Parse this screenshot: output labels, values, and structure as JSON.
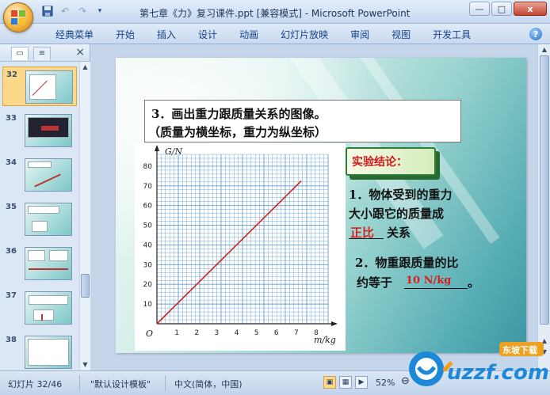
{
  "window": {
    "title": "第七章《力》复习课件.ppt [兼容模式] - Microsoft PowerPoint",
    "controls": [
      "—",
      "□",
      "x"
    ]
  },
  "qat": {
    "undo": "↶",
    "redo": "↷"
  },
  "ribbon": {
    "tabs": [
      "经典菜单",
      "开始",
      "插入",
      "设计",
      "动画",
      "幻灯片放映",
      "审阅",
      "视图",
      "开发工具"
    ],
    "help": "?"
  },
  "slide_pane": {
    "close": "×",
    "thumbnails": [
      {
        "num": "32",
        "selected": true
      },
      {
        "num": "33",
        "selected": false
      },
      {
        "num": "34",
        "selected": false
      },
      {
        "num": "35",
        "selected": false
      },
      {
        "num": "36",
        "selected": false
      },
      {
        "num": "37",
        "selected": false
      },
      {
        "num": "38",
        "selected": false
      }
    ]
  },
  "slide": {
    "question_line1": "3．画出重力跟质量关系的图像。",
    "question_line2": "（质量为横坐标，重力为纵坐标）",
    "conclusion_label": "实验结论：",
    "c1_line1": "1．物体受到的重力",
    "c1_line2": "大小跟它的质量成",
    "c1_answer": "正比",
    "c1_tail": "关系",
    "c2_line1": "2．物重跟质量的比",
    "c2_prefix": "约等于",
    "c2_answer": "10 N/kg",
    "c2_tail": "。"
  },
  "chart_data": {
    "type": "line",
    "xlabel": "m/kg",
    "ylabel": "G/N",
    "origin_label": "O",
    "x_ticks": [
      1,
      2,
      3,
      4,
      5,
      6,
      7,
      8
    ],
    "y_ticks": [
      10,
      20,
      30,
      40,
      50,
      60,
      70,
      80
    ],
    "xlim": [
      0,
      8.6
    ],
    "ylim": [
      0,
      86
    ],
    "grid": true,
    "grid_color": "#4d8fc9",
    "line_color": "#cc2222",
    "series": [
      {
        "x": [
          0,
          7.25
        ],
        "y": [
          0,
          72.5
        ]
      }
    ]
  },
  "status": {
    "slide_info": "幻灯片 32/46",
    "template": "\"默认设计模板\"",
    "language": "中文(简体，中国)",
    "zoom": "52%"
  },
  "watermark": {
    "brand": "uzzf.com",
    "tag": "东坡下载"
  }
}
